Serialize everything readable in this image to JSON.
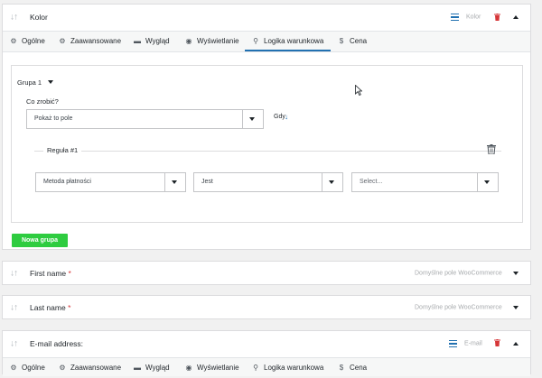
{
  "fields": {
    "kolor": {
      "title": "Kolor",
      "meta": "Kolor"
    },
    "first_name": {
      "title": "First name",
      "required_mark": "*",
      "meta": "Domyślne pole WooCommerce"
    },
    "last_name": {
      "title": "Last name",
      "required_mark": "*",
      "meta": "Domyślne pole WooCommerce"
    },
    "email": {
      "title": "E-mail address:",
      "meta": "E-mail"
    }
  },
  "tabs": [
    {
      "label": "Ogólne",
      "icon": "gear-icon"
    },
    {
      "label": "Zaawansowane",
      "icon": "gears-icon"
    },
    {
      "label": "Wygląd",
      "icon": "paint-roller-icon"
    },
    {
      "label": "Wyświetlanie",
      "icon": "eye-icon"
    },
    {
      "label": "Logika warunkowa",
      "icon": "magic-wand-icon"
    },
    {
      "label": "Cena",
      "icon": "dollar-icon"
    }
  ],
  "active_tab": "Logika warunkowa",
  "logic": {
    "group_label": "Grupa 1",
    "action_label": "Co zrobić?",
    "action_value": "Pokaż to pole",
    "when_label": "Gdy",
    "rule_label": "Reguła #1",
    "rule_field": "Metoda płatności",
    "rule_operator": "Jest",
    "rule_value_placeholder": "Select...",
    "new_group_button": "Nowa grupa"
  },
  "colors": {
    "accent": "#2271b1",
    "danger": "#d63638",
    "button_green": "#2ecc40"
  }
}
